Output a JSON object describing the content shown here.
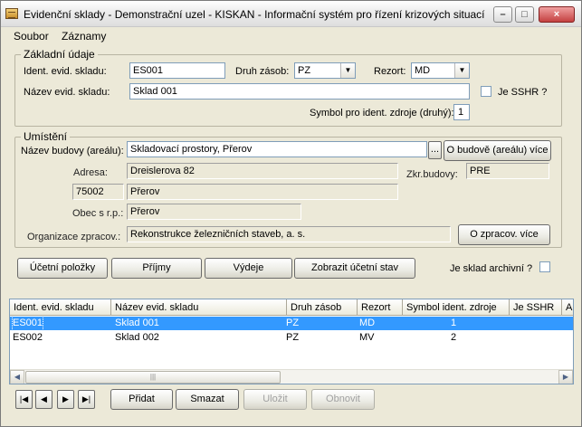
{
  "window": {
    "title": "Evidenční sklady - Demonstrační uzel - KISKAN - Informační systém pro řízení krizových situací",
    "minimize_glyph": "–",
    "maximize_glyph": "□",
    "close_glyph": "×"
  },
  "menu": [
    "Soubor",
    "Záznamy"
  ],
  "zakladni": {
    "legend": "Základní údaje",
    "ident_label": "Ident. evid. skladu:",
    "ident_value": "ES001",
    "druh_label": "Druh zásob:",
    "druh_value": "PZ",
    "rezort_label": "Rezort:",
    "rezort_value": "MD",
    "nazev_label": "Název evid. skladu:",
    "nazev_value": "Sklad 001",
    "sshr_label": "Je SSHR ?",
    "symbol_label": "Symbol pro ident. zdroje (druhý):",
    "symbol_value": "1"
  },
  "umisteni": {
    "legend": "Umístění",
    "budova_label": "Název budovy (areálu):",
    "budova_value": "Skladovací prostory, Přerov",
    "browse_label": "...",
    "budova_more_button": "O budově (areálu) více",
    "adresa_label": "Adresa:",
    "adresa_value": "Dreislerova 82",
    "zkr_label": "Zkr.budovy:",
    "zkr_value": "PRE",
    "psc_value": "75002",
    "mesto_value": "Přerov",
    "obec_label": "Obec s r.p.:",
    "obec_value": "Přerov",
    "org_label": "Organizace zpracov.:",
    "org_value": "Rekonstrukce železničních staveb, a. s.",
    "org_more_button": "O zpracov. více"
  },
  "actions": {
    "ucetni": "Účetní položky",
    "prijmy": "Příjmy",
    "vydeje": "Výdeje",
    "zobrazit": "Zobrazit účetní stav",
    "archiv_label": "Je sklad archivní ?"
  },
  "grid": {
    "columns": [
      "Ident. evid. skladu",
      "Název evid. skladu",
      "Druh zásob",
      "Rezort",
      "Symbol ident. zdroje",
      "Je SSHR",
      "A"
    ],
    "rows": [
      [
        "ES001",
        "Sklad 001",
        "PZ",
        "MD",
        "1",
        "",
        ""
      ],
      [
        "ES002",
        "Sklad 002",
        "PZ",
        "MV",
        "2",
        "",
        ""
      ]
    ],
    "selected_row": 0,
    "scroll_left": "◀",
    "scroll_right": "▶",
    "thumb_grip": "|||"
  },
  "nav": {
    "first": "|◀",
    "prev": "◀",
    "next": "▶",
    "last": "▶|",
    "pridat": "Přidat",
    "smazat": "Smazat",
    "ulozit": "Uložit",
    "obnovit": "Obnovit"
  }
}
